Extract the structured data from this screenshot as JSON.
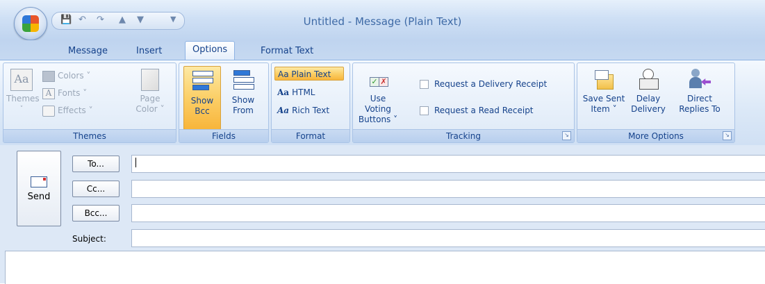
{
  "window": {
    "title": "Untitled  -  Message (Plain Text)"
  },
  "quick_access": {
    "icons": [
      "save-icon",
      "undo-icon",
      "redo-icon",
      "up-icon",
      "down-icon",
      "customize-dropdown-icon"
    ]
  },
  "tabs": [
    {
      "label": "Message"
    },
    {
      "label": "Insert"
    },
    {
      "label": "Options",
      "active": true
    },
    {
      "label": "Format Text"
    }
  ],
  "ribbon": {
    "themes_group": {
      "label": "Themes",
      "themes_btn": "Themes",
      "colors": "Colors",
      "fonts": "Fonts",
      "effects": "Effects",
      "page_color_line1": "Page",
      "page_color_line2": "Color"
    },
    "fields_group": {
      "label": "Fields",
      "show_bcc_line1": "Show",
      "show_bcc_line2": "Bcc",
      "show_from_line1": "Show",
      "show_from_line2": "From"
    },
    "format_group": {
      "label": "Format",
      "plain_text": "Aa Plain Text",
      "html": "HTML",
      "rich_text": "Rich Text",
      "aa": "Aa"
    },
    "tracking_group": {
      "label": "Tracking",
      "use_voting_line1": "Use Voting",
      "use_voting_line2": "Buttons",
      "delivery_receipt": "Request a Delivery Receipt",
      "read_receipt": "Request a Read Receipt"
    },
    "more_options_group": {
      "label": "More Options",
      "save_sent_line1": "Save Sent",
      "save_sent_line2": "Item",
      "delay_line1": "Delay",
      "delay_line2": "Delivery",
      "direct_line1": "Direct",
      "direct_line2": "Replies To"
    }
  },
  "compose": {
    "send_label": "Send",
    "to_label": "To...",
    "cc_label": "Cc...",
    "bcc_label": "Bcc...",
    "subject_label": "Subject:",
    "to_value": "",
    "cc_value": "",
    "bcc_value": "",
    "subject_value": ""
  },
  "colors": {
    "accent_text": "#15428b",
    "ribbon_selected": "#fbcf67"
  }
}
